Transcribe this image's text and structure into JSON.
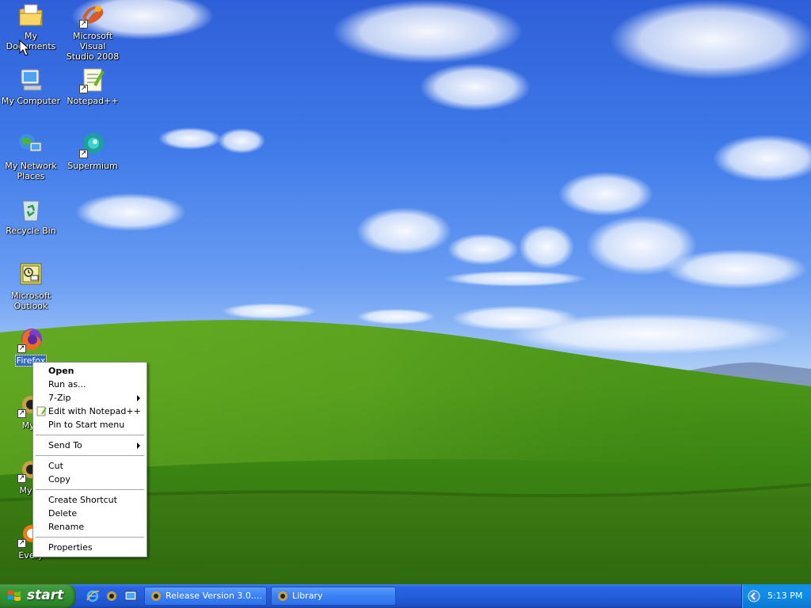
{
  "desktop": {
    "icons": [
      {
        "label": "My Documents",
        "icon": "my-documents-icon"
      },
      {
        "label": "Microsoft Visual Studio 2008",
        "line1": "Microsoft Visual",
        "line2": "Studio 2008",
        "icon": "visual-studio-icon"
      },
      {
        "label": "My Computer",
        "icon": "my-computer-icon"
      },
      {
        "label": "Notepad++",
        "icon": "notepadpp-icon"
      },
      {
        "label": "My Network Places",
        "line1": "My Network",
        "line2": "Places",
        "icon": "network-places-icon"
      },
      {
        "label": "Supermium",
        "icon": "supermium-icon"
      },
      {
        "label": "Recycle Bin",
        "icon": "recycle-bin-icon"
      },
      {
        "label": "Microsoft Outlook",
        "line1": "Microsoft",
        "line2": "Outlook",
        "icon": "outlook-icon"
      },
      {
        "label": "Firefox",
        "icon": "firefox-icon",
        "selected": true
      },
      {
        "label": "MyP",
        "icon": "mypal-icon"
      },
      {
        "label": "MyPa",
        "icon": "mypal-icon"
      },
      {
        "label": "Every",
        "icon": "everything-icon"
      }
    ]
  },
  "context_menu": {
    "items": [
      {
        "label": "Open",
        "bold": true
      },
      {
        "label": "Run as..."
      },
      {
        "label": "7-Zip",
        "submenu": true
      },
      {
        "label": "Edit with Notepad++",
        "icon": "notepadpp-small-icon"
      },
      {
        "label": "Pin to Start menu"
      },
      {
        "label": "Send To",
        "submenu": true
      },
      {
        "label": "Cut"
      },
      {
        "label": "Copy"
      },
      {
        "label": "Create Shortcut"
      },
      {
        "label": "Delete"
      },
      {
        "label": "Rename"
      },
      {
        "label": "Properties"
      }
    ]
  },
  "taskbar": {
    "start_label": "start",
    "quick_launch": [
      "ie-icon",
      "mypal-icon",
      "show-desktop-icon"
    ],
    "tasks": [
      {
        "label": "Release Version 3.0....",
        "icon": "mypal-icon"
      },
      {
        "label": "Library",
        "icon": "mypal-icon"
      }
    ],
    "tray": {
      "icons": [
        "volume-icon"
      ],
      "clock": "5:13 PM"
    }
  },
  "colors": {
    "taskbar_blue": "#245edb",
    "start_green": "#3c9a3a",
    "tray_blue": "#0f8ce5",
    "selection_blue": "#316ac5"
  }
}
